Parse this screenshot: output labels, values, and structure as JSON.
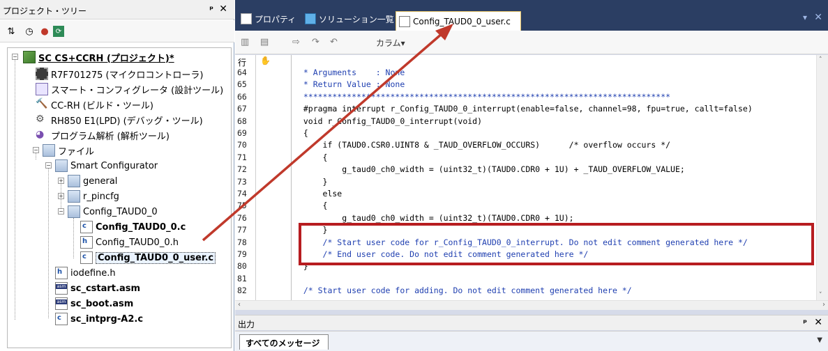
{
  "project_panel": {
    "title": "プロジェクト・ツリー",
    "pin": "ᵖ",
    "close": "×",
    "tree": {
      "project": "SC CS+CCRH (プロジェクト)*",
      "items": [
        "R7F701275 (マイクロコントローラ)",
        "スマート・コンフィグレータ (設計ツール)",
        "CC-RH (ビルド・ツール)",
        "RH850 E1(LPD) (デバッグ・ツール)",
        "プログラム解析 (解析ツール)"
      ],
      "files_folder": "ファイル",
      "smart_configurator": "Smart Configurator",
      "general": "general",
      "r_pincfg": "r_pincfg",
      "config_folder": "Config_TAUD0_0",
      "config_files": [
        "Config_TAUD0_0.c",
        "Config_TAUD0_0.h",
        "Config_TAUD0_0_user.c"
      ],
      "root_files": [
        "iodefine.h",
        "sc_cstart.asm",
        "sc_boot.asm",
        "sc_intprg-A2.c"
      ]
    }
  },
  "editor": {
    "tabs": [
      "プロパティ",
      "ソリューション一覧",
      "Config_TAUD0_0_user.c"
    ],
    "toolbar_column_label": "カラム▾",
    "row_header": "行",
    "code_lines": [
      {
        "n": "64",
        "text": "  * Arguments    : None"
      },
      {
        "n": "65",
        "text": "  * Return Value : None"
      },
      {
        "n": "66",
        "text": "  ****************************************************************************"
      },
      {
        "n": "67",
        "text": "  #pragma interrupt r_Config_TAUD0_0_interrupt(enable=false, channel=98, fpu=true, callt=false)"
      },
      {
        "n": "68",
        "text": "  void r_Config_TAUD0_0_interrupt(void)"
      },
      {
        "n": "69",
        "text": "  {"
      },
      {
        "n": "70",
        "text": "      if (TAUD0.CSR0.UINT8 & _TAUD_OVERFLOW_OCCURS)      /* overflow occurs */"
      },
      {
        "n": "71",
        "text": "      {"
      },
      {
        "n": "72",
        "text": "          g_taud0_ch0_width = (uint32_t)(TAUD0.CDR0 + 1U) + _TAUD_OVERFLOW_VALUE;"
      },
      {
        "n": "73",
        "text": "      }"
      },
      {
        "n": "74",
        "text": "      else"
      },
      {
        "n": "75",
        "text": "      {"
      },
      {
        "n": "76",
        "text": "          g_taud0_ch0_width = (uint32_t)(TAUD0.CDR0 + 1U);"
      },
      {
        "n": "77",
        "text": "      }"
      },
      {
        "n": "78",
        "text": "      /* Start user code for r_Config_TAUD0_0_interrupt. Do not edit comment generated here */"
      },
      {
        "n": "79",
        "text": "      /* End user code. Do not edit comment generated here */"
      },
      {
        "n": "80",
        "text": "  }"
      },
      {
        "n": "81",
        "text": ""
      },
      {
        "n": "82",
        "text": "  /* Start user code for adding. Do not edit comment generated here */"
      }
    ]
  },
  "output": {
    "title": "出力",
    "tab": "すべてのメッセージ"
  },
  "colors": {
    "highlight": "#b71d20",
    "tab_bar": "#2b3e63"
  }
}
